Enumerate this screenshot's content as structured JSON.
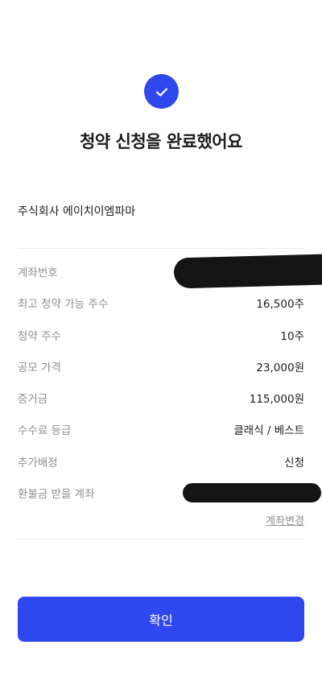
{
  "header": {
    "title": "청약 신청을 완료했어요",
    "icon": "check-icon",
    "accent": "#2f47ee"
  },
  "company": "주식회사 에이치이엠파마",
  "details": [
    {
      "label": "계좌번호",
      "value": ""
    },
    {
      "label": "최고 청약 가능 주수",
      "value": "16,500주"
    },
    {
      "label": "청약 주수",
      "value": "10주"
    },
    {
      "label": "공모 가격",
      "value": "23,000원"
    },
    {
      "label": "증거금",
      "value": "115,000원"
    },
    {
      "label": "수수료 등급",
      "value": "클래식 / 베스트"
    },
    {
      "label": "추가배정",
      "value": "신청"
    },
    {
      "label": "환불금 받을 계좌",
      "value": ""
    }
  ],
  "change_account_label": "계좌변경",
  "confirm_label": "확인"
}
